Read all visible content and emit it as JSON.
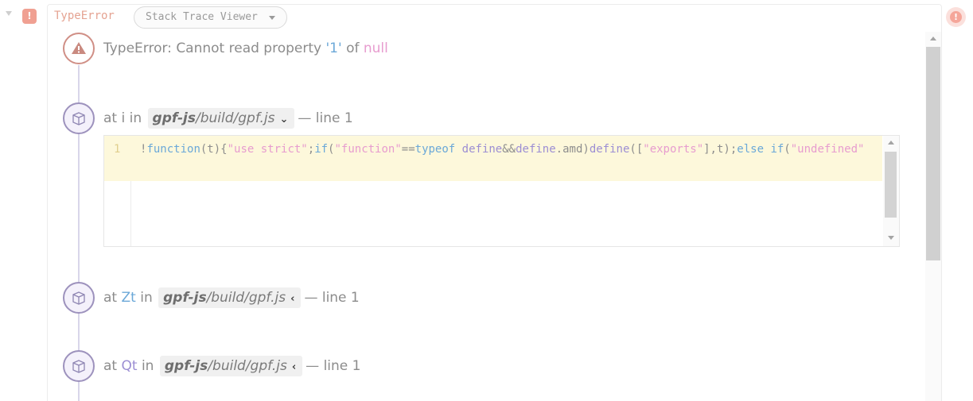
{
  "header": {
    "title": "TypeError",
    "viewer_label": "Stack Trace Viewer"
  },
  "error": {
    "prefix": "TypeError: Cannot read property ",
    "property": "'1'",
    "middle": " of ",
    "value": "null"
  },
  "frames": [
    {
      "at": "at ",
      "func": "i",
      "in": " in ",
      "repo": "gpf-js",
      "path": "/build/gpf.js",
      "chevron": "⌄",
      "line_label": "— line 1"
    },
    {
      "at": "at ",
      "func": "Zt",
      "in": " in ",
      "repo": "gpf-js",
      "path": "/build/gpf.js",
      "chevron": "‹",
      "line_label": "— line 1"
    },
    {
      "at": "at ",
      "func": "Qt",
      "in": " in ",
      "repo": "gpf-js",
      "path": "/build/gpf.js",
      "chevron": "‹",
      "line_label": "— line 1"
    }
  ],
  "code": {
    "line_number": "1",
    "tokens": [
      {
        "t": "!",
        "c": "plain"
      },
      {
        "t": "function",
        "c": "kw"
      },
      {
        "t": "(t){",
        "c": "plain"
      },
      {
        "t": "\"use strict\"",
        "c": "str"
      },
      {
        "t": ";",
        "c": "plain"
      },
      {
        "t": "if",
        "c": "kw"
      },
      {
        "t": "(",
        "c": "plain"
      },
      {
        "t": "\"function\"",
        "c": "str"
      },
      {
        "t": "==",
        "c": "plain"
      },
      {
        "t": "typeof",
        "c": "kw"
      },
      {
        "t": " ",
        "c": "plain"
      },
      {
        "t": "define",
        "c": "fn"
      },
      {
        "t": "&&",
        "c": "plain"
      },
      {
        "t": "define",
        "c": "fn"
      },
      {
        "t": ".amd)",
        "c": "plain"
      },
      {
        "t": "define",
        "c": "fn"
      },
      {
        "t": "([",
        "c": "plain"
      },
      {
        "t": "\"exports\"",
        "c": "str"
      },
      {
        "t": "],t);",
        "c": "plain"
      },
      {
        "t": "else",
        "c": "kw"
      },
      {
        "t": " ",
        "c": "plain"
      },
      {
        "t": "if",
        "c": "kw"
      },
      {
        "t": "(",
        "c": "plain"
      },
      {
        "t": "\"undefined\"",
        "c": "str"
      }
    ]
  },
  "icons": {
    "collapse": "chevron-down-icon",
    "error_badge": "exclamation-icon",
    "warning": "warning-triangle-icon",
    "frame": "package-box-icon"
  },
  "colors": {
    "error_accent": "#e5a392",
    "keyword": "#6ba8d8",
    "string": "#e79ccf",
    "function": "#9c8ed3",
    "highlight_row": "#fdf8db"
  }
}
